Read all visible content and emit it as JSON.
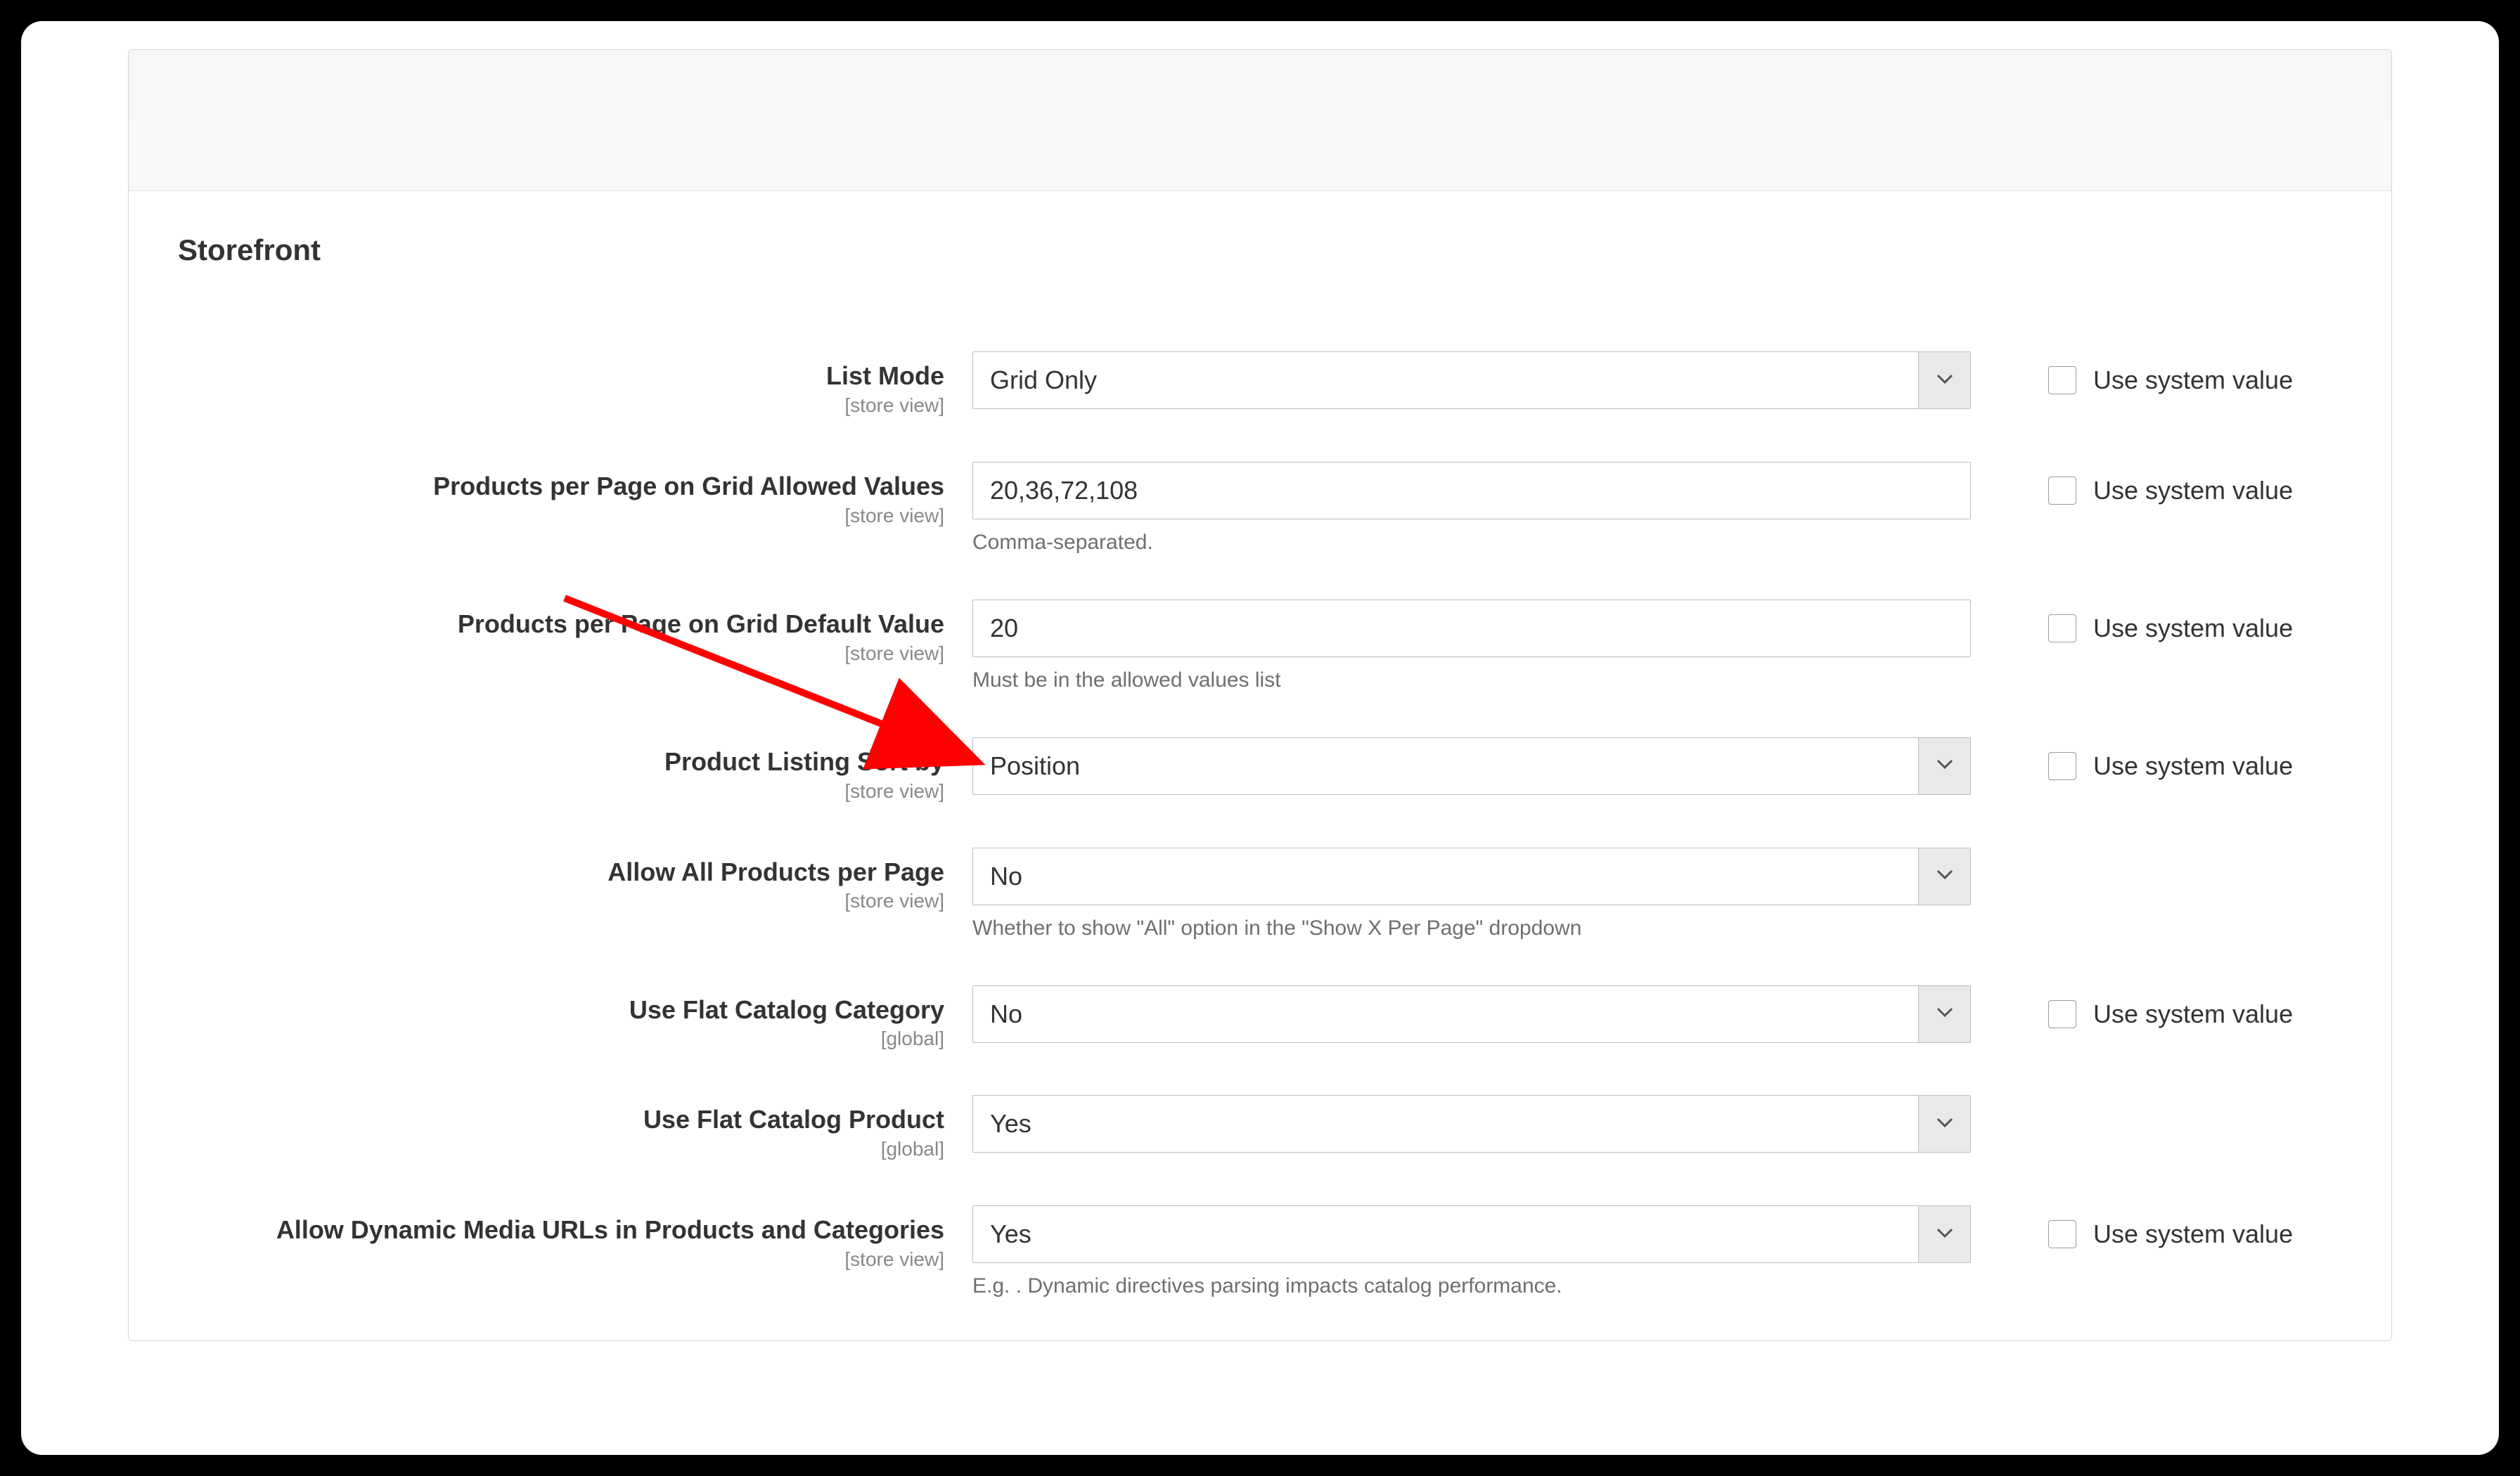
{
  "section_title": "Storefront",
  "scope_store_view": "[store view]",
  "scope_global": "[global]",
  "use_system_value": "Use system value",
  "fields": {
    "list_mode": {
      "label": "List Mode",
      "value": "Grid Only"
    },
    "grid_allowed": {
      "label": "Products per Page on Grid Allowed Values",
      "value": "20,36,72,108",
      "help": "Comma-separated."
    },
    "grid_default": {
      "label": "Products per Page on Grid Default Value",
      "value": "20",
      "help": "Must be in the allowed values list"
    },
    "sort_by": {
      "label": "Product Listing Sort by",
      "value": "Position"
    },
    "allow_all": {
      "label": "Allow All Products per Page",
      "value": "No",
      "help": "Whether to show \"All\" option in the \"Show X Per Page\" dropdown"
    },
    "flat_cat": {
      "label": "Use Flat Catalog Category",
      "value": "No"
    },
    "flat_prod": {
      "label": "Use Flat Catalog Product",
      "value": "Yes"
    },
    "dyn_media": {
      "label": "Allow Dynamic Media URLs in Products and Categories",
      "value": "Yes",
      "help": "E.g. . Dynamic directives parsing impacts catalog performance."
    }
  },
  "colors": {
    "arrow": "#ff0000"
  }
}
